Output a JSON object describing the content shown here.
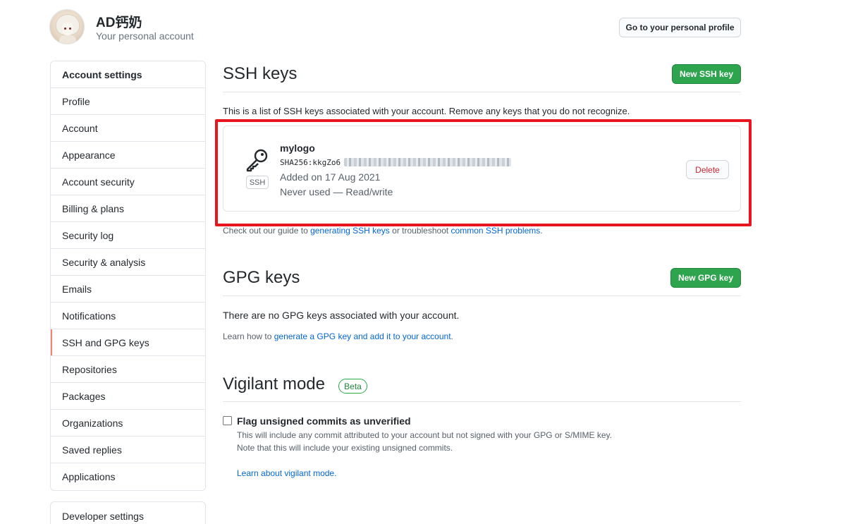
{
  "header": {
    "user_name": "AD钙奶",
    "user_subtitle": "Your personal account",
    "profile_button": "Go to your personal profile"
  },
  "sidebar": {
    "heading": "Account settings",
    "items": [
      {
        "label": "Profile"
      },
      {
        "label": "Account"
      },
      {
        "label": "Appearance"
      },
      {
        "label": "Account security"
      },
      {
        "label": "Billing & plans"
      },
      {
        "label": "Security log"
      },
      {
        "label": "Security & analysis"
      },
      {
        "label": "Emails"
      },
      {
        "label": "Notifications"
      },
      {
        "label": "SSH and GPG keys",
        "active": true
      },
      {
        "label": "Repositories"
      },
      {
        "label": "Packages"
      },
      {
        "label": "Organizations"
      },
      {
        "label": "Saved replies"
      },
      {
        "label": "Applications"
      }
    ],
    "developer_settings": "Developer settings"
  },
  "ssh": {
    "title": "SSH keys",
    "new_button": "New SSH key",
    "description": "This is a list of SSH keys associated with your account. Remove any keys that you do not recognize.",
    "key": {
      "type_label": "SSH",
      "title": "mylogo",
      "fingerprint_visible": "SHA256:kkgZo6",
      "added": "Added on 17 Aug 2021",
      "usage": "Never used — Read/write",
      "delete_button": "Delete"
    },
    "guide_prefix": "Check out our guide to ",
    "guide_link1": "generating SSH keys",
    "guide_middle": " or troubleshoot ",
    "guide_link2": "common SSH problems",
    "guide_suffix": "."
  },
  "gpg": {
    "title": "GPG keys",
    "new_button": "New GPG key",
    "empty_text": "There are no GPG keys associated with your account.",
    "learn_prefix": "Learn how to ",
    "learn_link": "generate a GPG key and add it to your account",
    "learn_suffix": "."
  },
  "vigilant": {
    "title": "Vigilant mode",
    "badge": "Beta",
    "checkbox_label": "Flag unsigned commits as unverified",
    "checked": false,
    "desc_line1": "This will include any commit attributed to your account but not signed with your GPG or S/MIME key.",
    "desc_line2": "Note that this will include your existing unsigned commits.",
    "learn_link": "Learn about vigilant mode."
  },
  "colors": {
    "accent_green": "#2ea44f",
    "link_blue": "#0366d6",
    "danger_red": "#cb2431",
    "highlight_box": "#e8141e",
    "active_indicator": "#f9826c"
  },
  "icons": {
    "key": "key-icon",
    "avatar": "user-avatar"
  }
}
